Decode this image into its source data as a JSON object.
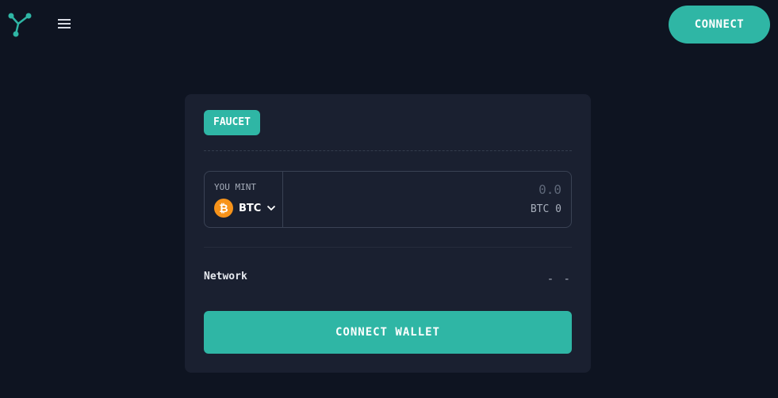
{
  "header": {
    "logo_icon": "network-nodes-icon",
    "menu_icon": "hamburger-menu-icon",
    "connect_label": "CONNECT"
  },
  "card": {
    "badge_label": "FAUCET",
    "mint": {
      "label": "YOU MINT",
      "token": "BTC",
      "token_icon": "bitcoin-icon",
      "amount_placeholder": "0.0",
      "balance": "BTC 0"
    },
    "network": {
      "label": "Network",
      "value": "- -"
    },
    "connect_wallet_label": "CONNECT WALLET"
  },
  "colors": {
    "background": "#0e1421",
    "card": "#1a2030",
    "accent": "#2fb6a5",
    "bitcoin": "#f7931a"
  }
}
